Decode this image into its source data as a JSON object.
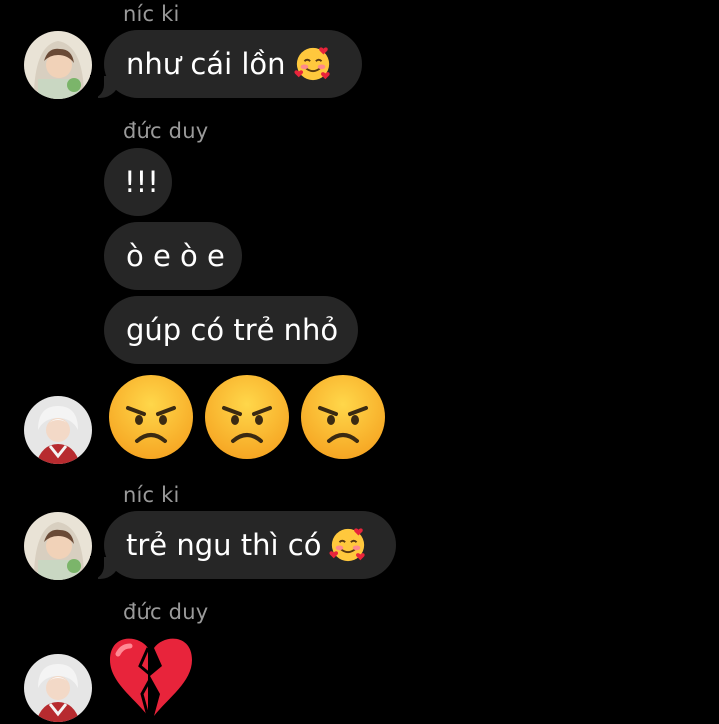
{
  "messages": [
    {
      "sender": "níc ki",
      "text": "như cái lồn",
      "emoji": "smiling-face-with-hearts"
    },
    {
      "sender": "đức duy",
      "texts": [
        "!!!",
        "ò e ò e",
        "gúp có trẻ nhỏ"
      ],
      "emoji_reply": [
        "angry-face",
        "angry-face",
        "angry-face"
      ]
    },
    {
      "sender": "níc ki",
      "text": "trẻ ngu thì có",
      "emoji": "smiling-face-with-hearts"
    },
    {
      "sender": "đức duy",
      "emoji_reply": "broken-heart"
    }
  ],
  "colors": {
    "background": "#000000",
    "bubble": "#262626",
    "sender": "#9a9a9a"
  }
}
